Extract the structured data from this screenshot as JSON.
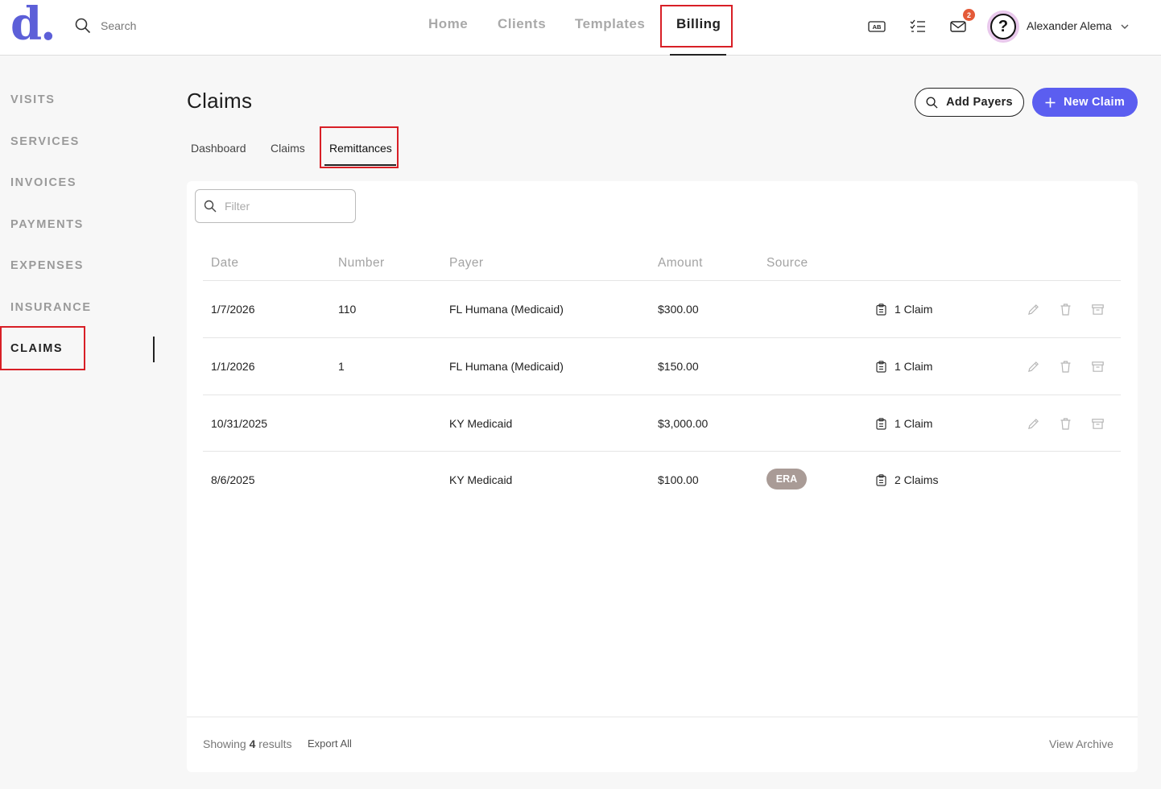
{
  "app": {
    "logo": "d."
  },
  "search": {
    "placeholder": "Search"
  },
  "nav": {
    "items": [
      {
        "label": "Home"
      },
      {
        "label": "Clients"
      },
      {
        "label": "Templates"
      },
      {
        "label": "Billing"
      }
    ],
    "active": "Billing"
  },
  "topbar": {
    "badge_icon_text": "AB",
    "inbox_count": "2",
    "user_name": "Alexander Alema",
    "avatar_glyph": "?"
  },
  "sidebar": {
    "items": [
      {
        "label": "VISITS"
      },
      {
        "label": "SERVICES"
      },
      {
        "label": "INVOICES"
      },
      {
        "label": "PAYMENTS"
      },
      {
        "label": "EXPENSES"
      },
      {
        "label": "INSURANCE"
      },
      {
        "label": "CLAIMS"
      }
    ],
    "active": "CLAIMS"
  },
  "page": {
    "title": "Claims",
    "add_payers_label": "Add Payers",
    "new_claim_label": "New Claim",
    "tabs": [
      {
        "label": "Dashboard"
      },
      {
        "label": "Claims"
      },
      {
        "label": "Remittances"
      }
    ],
    "active_tab": "Remittances"
  },
  "table": {
    "filter_placeholder": "Filter",
    "headers": {
      "date": "Date",
      "number": "Number",
      "payer": "Payer",
      "amount": "Amount",
      "source": "Source"
    },
    "rows": [
      {
        "date": "1/7/2026",
        "number": "110",
        "payer": "FL Humana (Medicaid)",
        "amount": "$300.00",
        "source": "",
        "claims": "1 Claim"
      },
      {
        "date": "1/1/2026",
        "number": "1",
        "payer": "FL Humana (Medicaid)",
        "amount": "$150.00",
        "source": "",
        "claims": "1 Claim"
      },
      {
        "date": "10/31/2025",
        "number": "",
        "payer": "KY Medicaid",
        "amount": "$3,000.00",
        "source": "",
        "claims": "1 Claim"
      },
      {
        "date": "8/6/2025",
        "number": "",
        "payer": "KY Medicaid",
        "amount": "$100.00",
        "source": "ERA",
        "claims": "2 Claims"
      }
    ]
  },
  "footer": {
    "showing_prefix": "Showing",
    "showing_count": "4",
    "showing_suffix": "results",
    "export_label": "Export All",
    "archive_label": "View Archive"
  },
  "colors": {
    "accent": "#5b5ef0",
    "logo": "#5c5fd8",
    "highlight_box": "#d81f26",
    "badge": "#e45a38",
    "era_chip": "#a99b96"
  }
}
